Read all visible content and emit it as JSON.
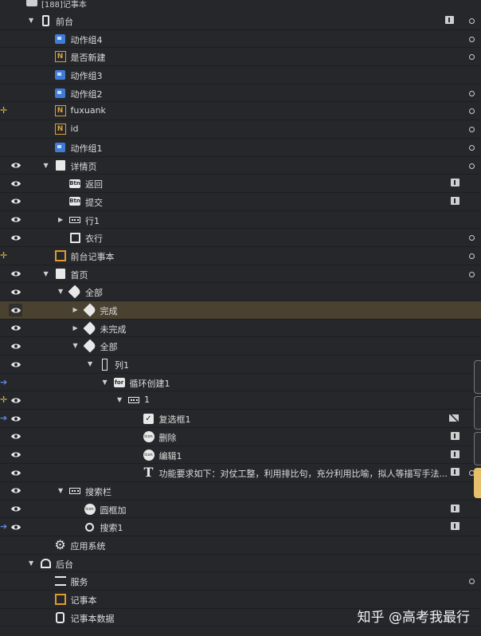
{
  "header": {
    "title": "[188]记事本"
  },
  "tree": [
    {
      "id": "qiantai",
      "label": "前台",
      "indent": 0,
      "toggle": "open",
      "icon": "phone-icon",
      "right": [
        "info",
        "dot"
      ],
      "eye": false
    },
    {
      "id": "dongzuozu4",
      "label": "动作组4",
      "indent": 1,
      "icon": "action-group-icon",
      "right": [
        "dot"
      ],
      "eye": false
    },
    {
      "id": "shifouxinjian",
      "label": "是否新建",
      "indent": 1,
      "icon": "variable-n-icon",
      "right": [
        "dot"
      ],
      "eye": false
    },
    {
      "id": "dongzuozu3",
      "label": "动作组3",
      "indent": 1,
      "icon": "action-group-icon",
      "right": [],
      "eye": false
    },
    {
      "id": "dongzuozu2",
      "label": "动作组2",
      "indent": 1,
      "icon": "action-group-icon",
      "right": [
        "dot"
      ],
      "eye": false
    },
    {
      "id": "fuxuank",
      "label": "fuxuank",
      "indent": 1,
      "icon": "variable-n-icon",
      "right": [
        "dot"
      ],
      "eye": false,
      "mark": "yellow"
    },
    {
      "id": "id",
      "label": "id",
      "indent": 1,
      "icon": "variable-n-icon",
      "right": [
        "dot"
      ],
      "eye": false
    },
    {
      "id": "dongzuozu1",
      "label": "动作组1",
      "indent": 1,
      "icon": "action-group-icon",
      "right": [
        "dot"
      ],
      "eye": false
    },
    {
      "id": "xiangqingye",
      "label": "详情页",
      "indent": 1,
      "toggle": "open",
      "icon": "page-icon",
      "right": [
        "dot"
      ],
      "eye": true
    },
    {
      "id": "fanhui",
      "label": "返回",
      "indent": 2,
      "icon": "button-icon",
      "right": [
        "info"
      ],
      "eye": true
    },
    {
      "id": "tijiao",
      "label": "提交",
      "indent": 2,
      "icon": "button-icon",
      "right": [
        "info"
      ],
      "eye": true
    },
    {
      "id": "hang1",
      "label": "行1",
      "indent": 2,
      "toggle": "closed",
      "icon": "row-icon",
      "right": [],
      "eye": true
    },
    {
      "id": "yihang",
      "label": "衣行",
      "indent": 2,
      "icon": "edit-icon",
      "right": [
        "dot"
      ],
      "eye": true
    },
    {
      "id": "qiantaijishiben",
      "label": "前台记事本",
      "indent": 1,
      "icon": "component-icon",
      "right": [
        "dot"
      ],
      "eye": false,
      "mark": "yellow"
    },
    {
      "id": "shouye",
      "label": "首页",
      "indent": 1,
      "toggle": "open",
      "icon": "page-icon",
      "right": [
        "dot"
      ],
      "eye": true
    },
    {
      "id": "quanbu-a",
      "label": "全部",
      "indent": 2,
      "toggle": "open",
      "icon": "tag-icon",
      "right": [],
      "eye": true
    },
    {
      "id": "wancheng",
      "label": "完成",
      "indent": 3,
      "toggle": "closed",
      "icon": "tag-icon",
      "right": [],
      "eye": true,
      "selected": true
    },
    {
      "id": "weiwancheng",
      "label": "未完成",
      "indent": 3,
      "toggle": "closed",
      "icon": "tag-icon",
      "right": [],
      "eye": true
    },
    {
      "id": "quanbu-b",
      "label": "全部",
      "indent": 3,
      "toggle": "open",
      "icon": "tag-icon",
      "right": [],
      "eye": true
    },
    {
      "id": "lie1",
      "label": "列1",
      "indent": 4,
      "toggle": "open",
      "icon": "column-icon",
      "right": [],
      "eye": true
    },
    {
      "id": "xunhuanchuangjian1",
      "label": "循环创建1",
      "indent": 5,
      "toggle": "open",
      "icon": "for-loop-icon",
      "right": [],
      "eye": false,
      "mark": "blue"
    },
    {
      "id": "row-1",
      "label": "1",
      "indent": 6,
      "toggle": "open",
      "icon": "row-icon",
      "right": [],
      "eye": true,
      "mark": "yellow"
    },
    {
      "id": "fuxuankuang1",
      "label": "复选框1",
      "indent": 7,
      "icon": "checkbox-icon",
      "right": [
        "hidden"
      ],
      "eye": true,
      "mark": "blue"
    },
    {
      "id": "shanchu",
      "label": "删除",
      "indent": 7,
      "icon": "icon-component-icon",
      "right": [
        "info"
      ],
      "eye": true
    },
    {
      "id": "bianji1",
      "label": "编辑1",
      "indent": 7,
      "icon": "icon-component-icon",
      "right": [
        "info"
      ],
      "eye": true
    },
    {
      "id": "text-req",
      "label": "功能要求如下：对仗工整，利用排比句，充分利用比喻，拟人等描写手法...",
      "indent": 7,
      "icon": "text-icon",
      "right": [
        "info",
        "dot"
      ],
      "eye": true
    },
    {
      "id": "sousuolan",
      "label": "搜索栏",
      "indent": 2,
      "toggle": "open",
      "icon": "row-icon",
      "right": [],
      "eye": true
    },
    {
      "id": "yuankuangjia",
      "label": "圆框加",
      "indent": 3,
      "icon": "icon-component-icon",
      "right": [
        "info"
      ],
      "eye": true
    },
    {
      "id": "sousuo1",
      "label": "搜索1",
      "indent": 3,
      "icon": "search-icon",
      "right": [
        "info"
      ],
      "eye": true,
      "mark": "blue"
    },
    {
      "id": "yingyongxitong",
      "label": "应用系统",
      "indent": 1,
      "icon": "gear-icon",
      "right": [],
      "eye": false
    },
    {
      "id": "houtai",
      "label": "后台",
      "indent": 0,
      "toggle": "open",
      "icon": "backend-icon",
      "right": [],
      "eye": false
    },
    {
      "id": "fuwu",
      "label": "服务",
      "indent": 1,
      "icon": "service-icon",
      "right": [
        "dot"
      ],
      "eye": false
    },
    {
      "id": "jishiben",
      "label": "记事本",
      "indent": 1,
      "icon": "component-icon",
      "right": [],
      "eye": false
    },
    {
      "id": "jishibenshuju",
      "label": "记事本数据",
      "indent": 1,
      "icon": "database-icon",
      "right": [],
      "eye": false
    }
  ],
  "watermark": "知乎 @高考我最行"
}
